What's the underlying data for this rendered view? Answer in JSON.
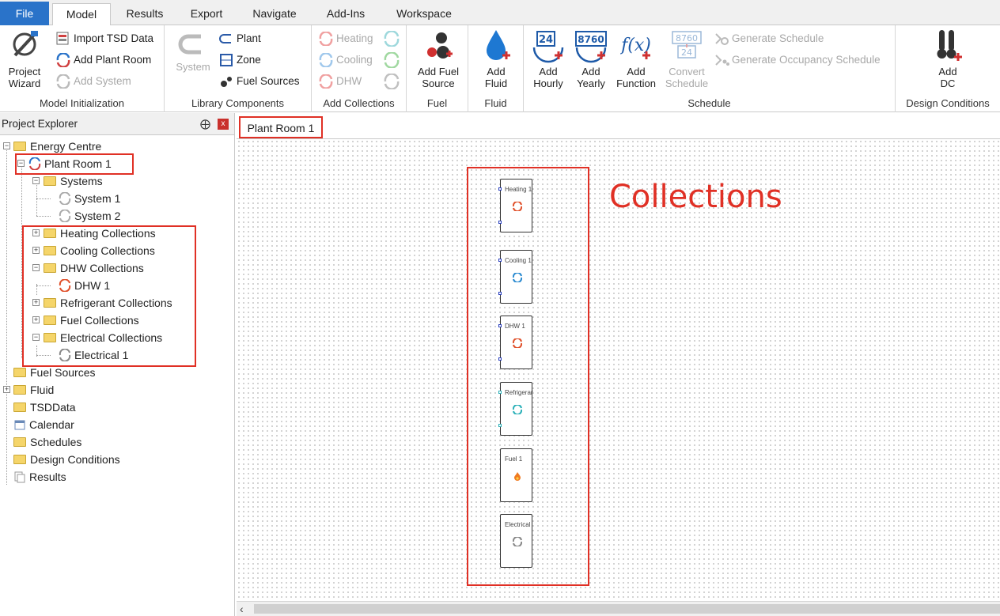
{
  "tabs": [
    "File",
    "Model",
    "Results",
    "Export",
    "Navigate",
    "Add-Ins",
    "Workspace"
  ],
  "active_tab": "Model",
  "ribbon": {
    "model_initialization": {
      "label": "Model Initialization",
      "project_wizard": "Project\nWizard",
      "import_tsd": "Import TSD Data",
      "add_plant_room": "Add Plant Room",
      "add_system": "Add System"
    },
    "library_components": {
      "label": "Library Components",
      "system": "System",
      "plant": "Plant",
      "zone": "Zone",
      "fuel_sources": "Fuel Sources"
    },
    "add_collections": {
      "label": "Add Collections",
      "heating": "Heating",
      "cooling": "Cooling",
      "dhw": "DHW"
    },
    "fuel": {
      "label": "Fuel",
      "add_fuel_source": "Add Fuel\nSource"
    },
    "fluid": {
      "label": "Fluid",
      "add_fluid": "Add\nFluid"
    },
    "schedule": {
      "label": "Schedule",
      "add_hourly": "Add\nHourly",
      "add_yearly": "Add\nYearly",
      "add_function": "Add\nFunction",
      "convert_schedule": "Convert\nSchedule",
      "generate_schedule": "Generate Schedule",
      "generate_occupancy": "Generate Occupancy Schedule",
      "icon_24": "24",
      "icon_8760": "8760",
      "icon_fx": "f(x)",
      "icon_conv_top": "8760",
      "icon_conv_bot": "24"
    },
    "design_conditions": {
      "label": "Design Conditions",
      "add_dc": "Add\nDC"
    }
  },
  "explorer": {
    "title": "Project Explorer",
    "pin": "⨁",
    "close": "x",
    "nodes": {
      "energy_centre": "Energy Centre",
      "plant_room_1": "Plant Room 1",
      "systems": "Systems",
      "system_1": "System 1",
      "system_2": "System 2",
      "heating_collections": "Heating Collections",
      "cooling_collections": "Cooling Collections",
      "dhw_collections": "DHW Collections",
      "dhw_1": "DHW 1",
      "refrigerant_collections": "Refrigerant Collections",
      "fuel_collections": "Fuel Collections",
      "electrical_collections": "Electrical Collections",
      "electrical_1": "Electrical 1",
      "fuel_sources": "Fuel Sources",
      "fluid": "Fluid",
      "tsddata": "TSDData",
      "calendar": "Calendar",
      "schedules": "Schedules",
      "design_conditions": "Design Conditions",
      "results": "Results"
    }
  },
  "document_tab": "Plant Room 1",
  "canvas": {
    "annotation": "Collections",
    "blocks": [
      {
        "label": "Heating 1",
        "color": "#e0502a"
      },
      {
        "label": "Cooling 1",
        "color": "#2a8ad0"
      },
      {
        "label": "DHW 1",
        "color": "#e0502a"
      },
      {
        "label": "Refrigeran",
        "color": "#2ab0b8"
      },
      {
        "label": "Fuel 1",
        "color": "#f07a20"
      },
      {
        "label": "Electrical",
        "color": "#888888"
      }
    ]
  },
  "colors": {
    "accent": "#2a73c9",
    "highlight": "#e03025"
  }
}
